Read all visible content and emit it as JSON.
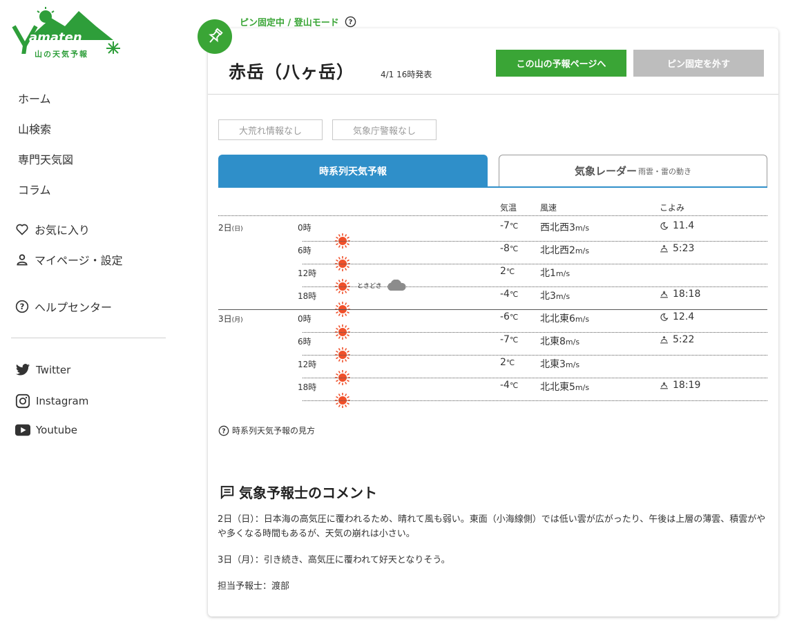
{
  "logo": {
    "text": "山の天気予報",
    "wordmark": "amaten"
  },
  "nav": {
    "items": [
      "ホーム",
      "山検索",
      "専門天気図",
      "コラム"
    ],
    "favorites": "お気に入り",
    "mypage": "マイページ・設定",
    "help": "ヘルプセンター"
  },
  "social": {
    "twitter": "Twitter",
    "instagram": "Instagram",
    "youtube": "Youtube"
  },
  "pin": {
    "label": "ピン固定中 / 登山モード"
  },
  "mountain": {
    "name": "赤岳（八ヶ岳）",
    "issued": "4/1 16時発表"
  },
  "buttons": {
    "forecast_page": "この山の予報ページへ",
    "unpin": "ピン固定を外す"
  },
  "alerts": {
    "storm": "大荒れ情報なし",
    "jma": "気象庁警報なし"
  },
  "tabs": {
    "timeseries": "時系列天気予報",
    "radar": "気象レーダー",
    "radar_sub": "雨雲・雷の動き"
  },
  "table": {
    "headers": {
      "temp": "気温",
      "wind": "風速",
      "koyomi": "こよみ"
    },
    "unit_temp": "℃",
    "unit_wind": "m/s",
    "sometimes": "ときどき",
    "days": [
      {
        "day": "2日",
        "dow": "(日)"
      },
      {
        "day": "3日",
        "dow": "(月)"
      }
    ],
    "rows": [
      {
        "hour": "0時",
        "temp": "-7",
        "wind_dir": "西北西",
        "wind_speed": "3",
        "koyomi": "11.4",
        "koyomi_icon": "moon-icon"
      },
      {
        "hour": "6時",
        "temp": "-8",
        "wind_dir": "北北西",
        "wind_speed": "2",
        "koyomi": "5:23",
        "koyomi_icon": "sunrise-icon"
      },
      {
        "hour": "12時",
        "temp": "2",
        "wind_dir": "北",
        "wind_speed": "1",
        "koyomi": "",
        "koyomi_icon": ""
      },
      {
        "hour": "18時",
        "temp": "-4",
        "wind_dir": "北",
        "wind_speed": "3",
        "koyomi": "18:18",
        "koyomi_icon": "sunset-icon"
      },
      {
        "hour": "0時",
        "temp": "-6",
        "wind_dir": "北北東",
        "wind_speed": "6",
        "koyomi": "12.4",
        "koyomi_icon": "moon-icon"
      },
      {
        "hour": "6時",
        "temp": "-7",
        "wind_dir": "北東",
        "wind_speed": "8",
        "koyomi": "5:22",
        "koyomi_icon": "sunrise-icon"
      },
      {
        "hour": "12時",
        "temp": "2",
        "wind_dir": "北東",
        "wind_speed": "3",
        "koyomi": "",
        "koyomi_icon": ""
      },
      {
        "hour": "18時",
        "temp": "-4",
        "wind_dir": "北北東",
        "wind_speed": "5",
        "koyomi": "18:19",
        "koyomi_icon": "sunset-icon"
      }
    ]
  },
  "howto": "時系列天気予報の見方",
  "comment": {
    "title": "気象予報士のコメント",
    "p1": "2日（日）：日本海の高気圧に覆われるため、晴れて風も弱い。東面（小海線側）では低い雲が広がったり、午後は上層の薄雲、積雲がやや多くなる時間もあるが、天気の崩れは小さい。",
    "p2": "3日（月）：引き続き、高気圧に覆われて好天となりそう。",
    "p3": "担当予報士：渡部"
  },
  "colors": {
    "green": "#3aa536",
    "blue": "#2f8fc9",
    "sun": "#f0502a"
  }
}
